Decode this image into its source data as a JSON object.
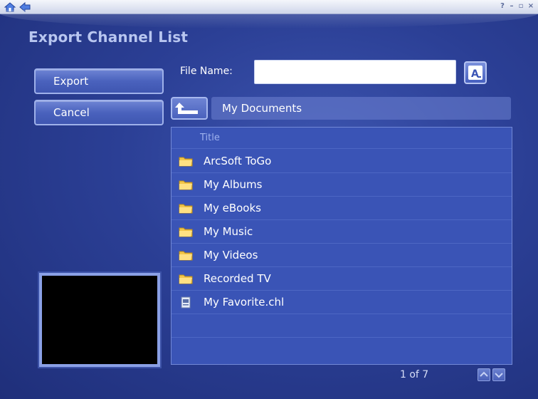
{
  "window": {
    "nav_icons": [
      "home-icon",
      "back-arrow-icon"
    ],
    "controls": [
      "help-icon",
      "minimize-icon",
      "restore-icon",
      "close-icon"
    ]
  },
  "page": {
    "title": "Export Channel List"
  },
  "sidebar": {
    "export_label": "Export",
    "cancel_label": "Cancel"
  },
  "file": {
    "label": "File Name:",
    "value": "",
    "keyboard_icon": "on-screen-keyboard-icon"
  },
  "location": {
    "up_icon": "up-folder-arrow-icon",
    "path": "My Documents"
  },
  "list": {
    "header": "Title",
    "items": [
      {
        "name": "ArcSoft ToGo",
        "icon": "folder-icon"
      },
      {
        "name": "My Albums",
        "icon": "folder-icon"
      },
      {
        "name": "My eBooks",
        "icon": "folder-icon"
      },
      {
        "name": "My Music",
        "icon": "folder-icon"
      },
      {
        "name": "My Videos",
        "icon": "folder-icon"
      },
      {
        "name": "Recorded TV",
        "icon": "folder-icon"
      },
      {
        "name": "My Favorite.chl",
        "icon": "channel-file-icon"
      }
    ]
  },
  "pager": {
    "text": "1 of 7"
  },
  "colors": {
    "accent": "#3a54b6",
    "background": "#2b3f95",
    "title": "#b8c6f0"
  }
}
